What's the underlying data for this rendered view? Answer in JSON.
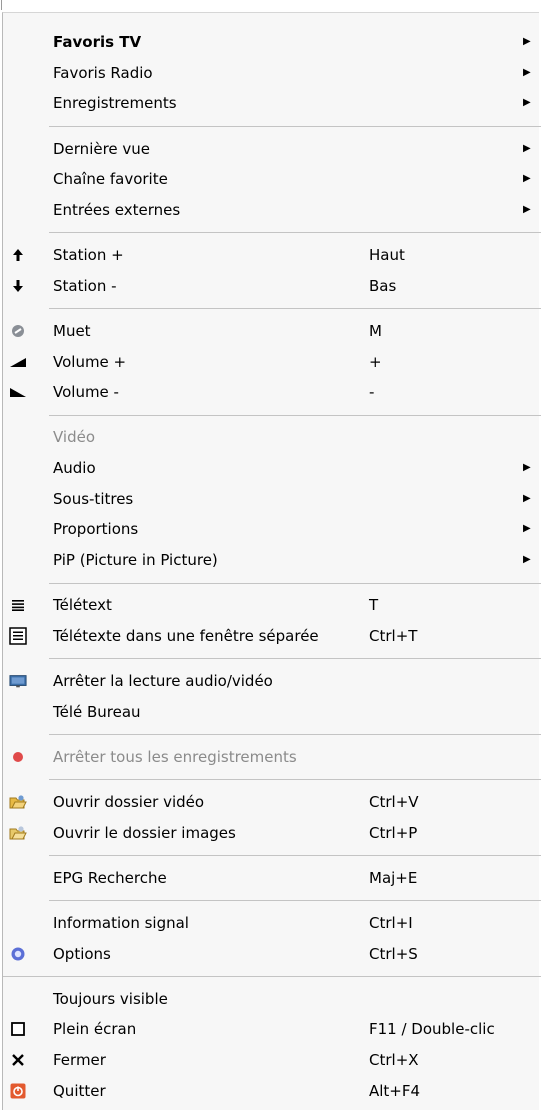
{
  "menu": {
    "groups": [
      [
        {
          "label": "Favoris TV",
          "bold": true,
          "submenu": true
        },
        {
          "label": "Favoris Radio",
          "submenu": true
        },
        {
          "label": "Enregistrements",
          "submenu": true
        }
      ],
      [
        {
          "label": "Dernière vue",
          "submenu": true
        },
        {
          "label": "Chaîne favorite",
          "submenu": true
        },
        {
          "label": "Entrées externes",
          "submenu": true
        }
      ],
      [
        {
          "label": "Station +",
          "shortcut": "Haut",
          "icon": "arrow-up-icon"
        },
        {
          "label": "Station -",
          "shortcut": "Bas",
          "icon": "arrow-down-icon"
        }
      ],
      [
        {
          "label": "Muet",
          "shortcut": "M",
          "icon": "mute-icon"
        },
        {
          "label": "Volume +",
          "shortcut": "+",
          "icon": "volume-up-icon"
        },
        {
          "label": "Volume -",
          "shortcut": "-",
          "icon": "volume-down-icon"
        }
      ],
      [
        {
          "label": "Vidéo",
          "disabled": true
        },
        {
          "label": "Audio",
          "submenu": true
        },
        {
          "label": "Sous-titres",
          "submenu": true
        },
        {
          "label": "Proportions",
          "submenu": true
        },
        {
          "label": "PiP (Picture in Picture)",
          "submenu": true
        }
      ],
      [
        {
          "label": "Télétext",
          "shortcut": "T",
          "icon": "teletext-icon"
        },
        {
          "label": "Télétexte dans une fenêtre séparée",
          "shortcut": "Ctrl+T",
          "icon": "teletext-window-icon"
        }
      ],
      [
        {
          "label": "Arrêter la lecture audio/vidéo",
          "icon": "monitor-icon"
        },
        {
          "label": "Télé Bureau"
        }
      ],
      [
        {
          "label": "Arrêter tous les enregistrements",
          "disabled": true,
          "icon": "record-icon"
        }
      ],
      [
        {
          "label": "Ouvrir dossier vidéo",
          "shortcut": "Ctrl+V",
          "icon": "folder-video-icon"
        },
        {
          "label": "Ouvrir le dossier images",
          "shortcut": "Ctrl+P",
          "icon": "folder-images-icon"
        }
      ],
      [
        {
          "label": "EPG Recherche",
          "shortcut": "Maj+E"
        }
      ],
      [
        {
          "label": "Information signal",
          "shortcut": "Ctrl+I"
        },
        {
          "label": "Options",
          "shortcut": "Ctrl+S",
          "icon": "options-gear-icon"
        }
      ],
      [
        {
          "label": "Toujours visible"
        },
        {
          "label": "Plein écran",
          "shortcut": "F11 / Double-clic",
          "icon": "fullscreen-icon"
        },
        {
          "label": "Fermer",
          "shortcut": "Ctrl+X",
          "icon": "close-icon"
        },
        {
          "label": "Quitter",
          "shortcut": "Alt+F4",
          "icon": "quit-icon"
        }
      ]
    ]
  }
}
